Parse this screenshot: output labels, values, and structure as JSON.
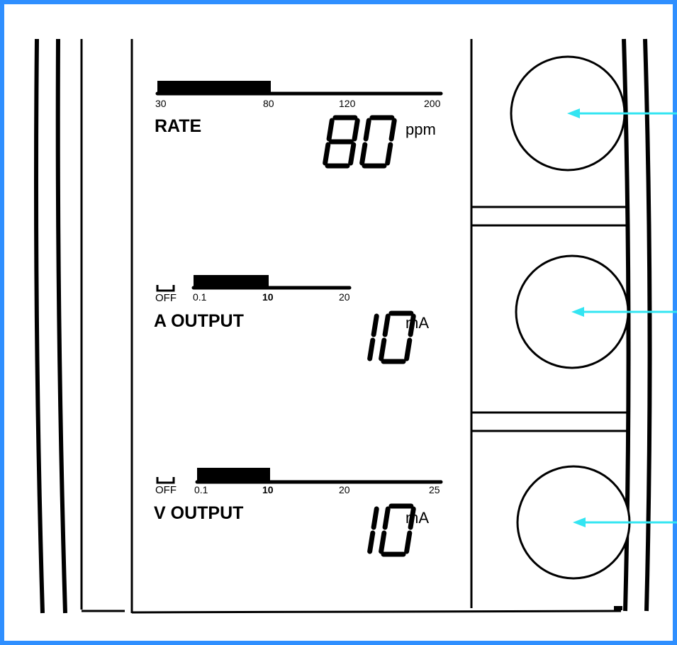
{
  "colors": {
    "frame": "#2f8fff",
    "arrow": "#33e5f2",
    "ink": "#000000"
  },
  "rate": {
    "label": "RATE",
    "value": "80",
    "unit": "ppm",
    "ticks": [
      "30",
      "80",
      "120",
      "200"
    ],
    "bar_fraction": 0.4
  },
  "a_output": {
    "label": "A OUTPUT",
    "value": "10",
    "unit": "mA",
    "off_label": "OFF",
    "ticks": [
      "0.1",
      "10",
      "20"
    ],
    "bar_fraction": 0.48
  },
  "v_output": {
    "label": "V OUTPUT",
    "value": "10",
    "unit": "mA",
    "off_label": "OFF",
    "ticks": [
      "0.1",
      "10",
      "20",
      "25"
    ],
    "bar_fraction": 0.3
  },
  "knobs": [
    "rate-knob",
    "a-output-knob",
    "v-output-knob"
  ]
}
